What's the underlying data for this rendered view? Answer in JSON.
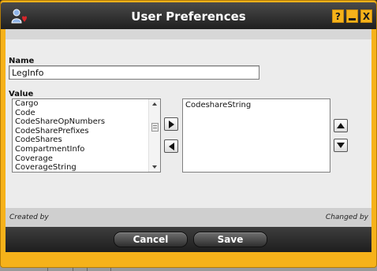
{
  "window": {
    "title": "User Preferences",
    "help_label": "?",
    "close_label": "X",
    "icon": "user-heart-icon"
  },
  "form": {
    "name_label": "Name",
    "name_value": "LegInfo",
    "value_label": "Value"
  },
  "available_list": {
    "items": [
      "Cargo",
      "Code",
      "CodeShareOpNumbers",
      "CodeSharePrefixes",
      "CodeShares",
      "CompartmentInfo",
      "Coverage",
      "CoverageString"
    ]
  },
  "selected_list": {
    "items": [
      "CodeshareString"
    ]
  },
  "meta": {
    "created_by": "Created by",
    "changed_by": "Changed by"
  },
  "footer": {
    "cancel_label": "Cancel",
    "save_label": "Save"
  },
  "colors": {
    "accent": "#f6b21a",
    "titlebar": "#2b2b2b",
    "panel": "#ececec"
  }
}
